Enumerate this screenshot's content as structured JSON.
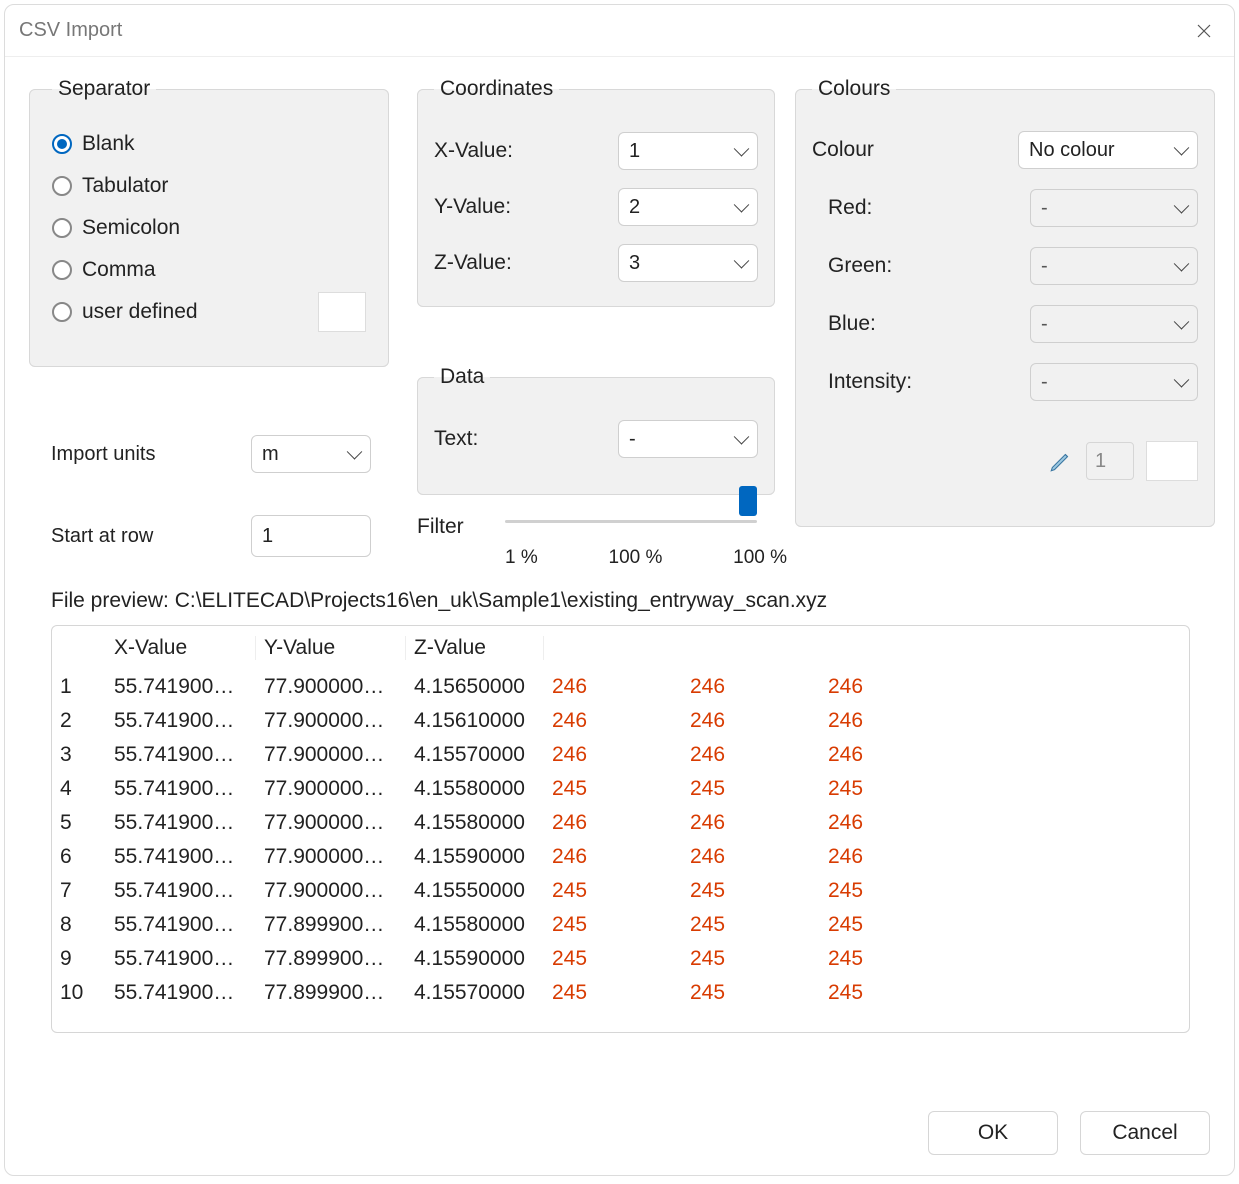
{
  "title": "CSV Import",
  "separator": {
    "legend": "Separator",
    "options": [
      {
        "label": "Blank",
        "checked": true
      },
      {
        "label": "Tabulator",
        "checked": false
      },
      {
        "label": "Semicolon",
        "checked": false
      },
      {
        "label": "Comma",
        "checked": false
      },
      {
        "label": "user defined",
        "checked": false
      }
    ],
    "userValue": ""
  },
  "importUnits": {
    "label": "Import units",
    "value": "m"
  },
  "startRow": {
    "label": "Start at row",
    "value": "1"
  },
  "coordinates": {
    "legend": "Coordinates",
    "x": {
      "label": "X-Value:",
      "value": "1"
    },
    "y": {
      "label": "Y-Value:",
      "value": "2"
    },
    "z": {
      "label": "Z-Value:",
      "value": "3"
    }
  },
  "data": {
    "legend": "Data",
    "text": {
      "label": "Text:",
      "value": "-"
    }
  },
  "filter": {
    "label": "Filter",
    "tick1": "1 %",
    "tick2": "100 %",
    "tick3": "100 %",
    "value": 100
  },
  "colours": {
    "legend": "Colours",
    "colour": {
      "label": "Colour",
      "value": "No colour"
    },
    "red": {
      "label": "Red:",
      "value": "-"
    },
    "green": {
      "label": "Green:",
      "value": "-"
    },
    "blue": {
      "label": "Blue:",
      "value": "-"
    },
    "intensity": {
      "label": "Intensity:",
      "value": "-"
    },
    "penValue": "1"
  },
  "preview": {
    "label": "File preview: C:\\ELITECAD\\Projects16\\en_uk\\Sample1\\existing_entryway_scan.xyz",
    "headers": [
      "",
      "X-Value",
      "Y-Value",
      "Z-Value",
      "",
      "",
      "",
      ""
    ],
    "rows": [
      {
        "n": "1",
        "x": "55.741900…",
        "y": "77.900000…",
        "z": "4.15650000",
        "r": "246",
        "g": "246",
        "b": "246"
      },
      {
        "n": "2",
        "x": "55.741900…",
        "y": "77.900000…",
        "z": "4.15610000",
        "r": "246",
        "g": "246",
        "b": "246"
      },
      {
        "n": "3",
        "x": "55.741900…",
        "y": "77.900000…",
        "z": "4.15570000",
        "r": "246",
        "g": "246",
        "b": "246"
      },
      {
        "n": "4",
        "x": "55.741900…",
        "y": "77.900000…",
        "z": "4.15580000",
        "r": "245",
        "g": "245",
        "b": "245"
      },
      {
        "n": "5",
        "x": "55.741900…",
        "y": "77.900000…",
        "z": "4.15580000",
        "r": "246",
        "g": "246",
        "b": "246"
      },
      {
        "n": "6",
        "x": "55.741900…",
        "y": "77.900000…",
        "z": "4.15590000",
        "r": "246",
        "g": "246",
        "b": "246"
      },
      {
        "n": "7",
        "x": "55.741900…",
        "y": "77.900000…",
        "z": "4.15550000",
        "r": "245",
        "g": "245",
        "b": "245"
      },
      {
        "n": "8",
        "x": "55.741900…",
        "y": "77.899900…",
        "z": "4.15580000",
        "r": "245",
        "g": "245",
        "b": "245"
      },
      {
        "n": "9",
        "x": "55.741900…",
        "y": "77.899900…",
        "z": "4.15590000",
        "r": "245",
        "g": "245",
        "b": "245"
      },
      {
        "n": "10",
        "x": "55.741900…",
        "y": "77.899900…",
        "z": "4.15570000",
        "r": "245",
        "g": "245",
        "b": "245"
      }
    ]
  },
  "buttons": {
    "ok": "OK",
    "cancel": "Cancel"
  }
}
